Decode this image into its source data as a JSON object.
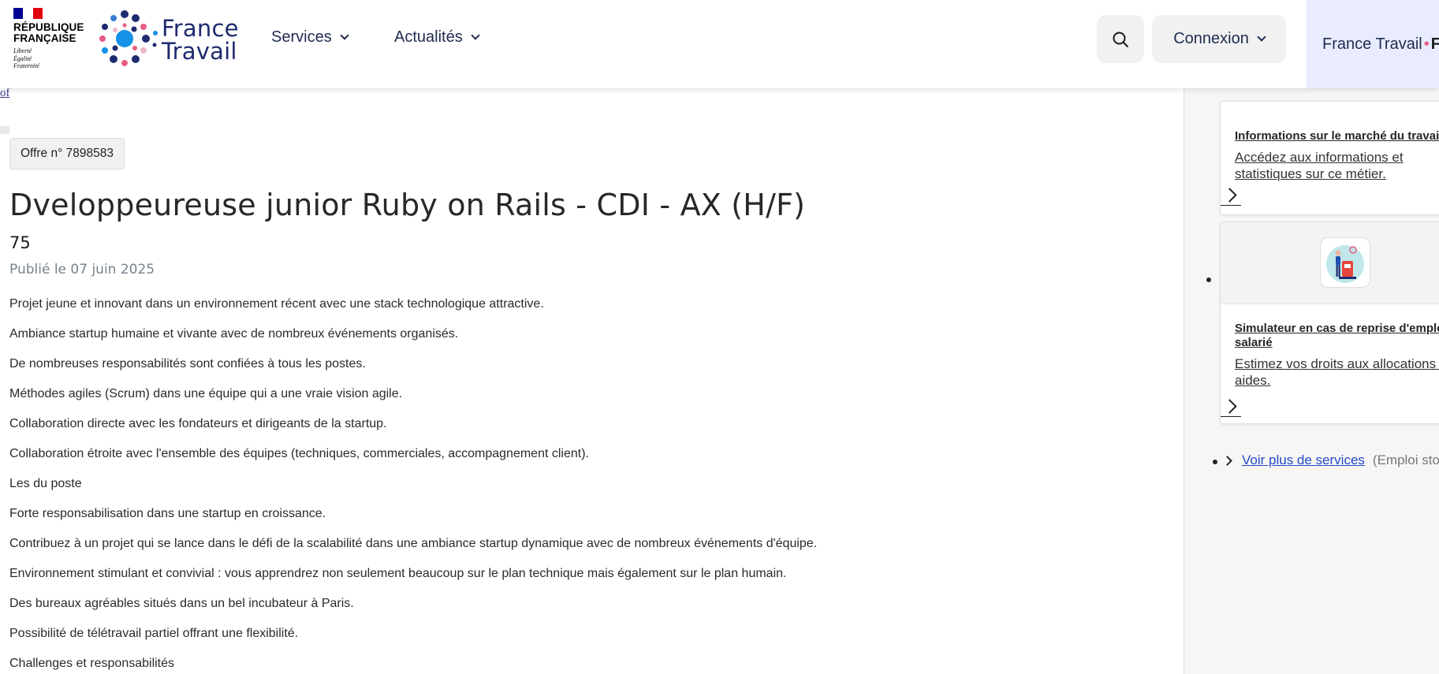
{
  "header": {
    "republique": {
      "line1": "RÉPUBLIQUE",
      "line2": "FRANÇAISE",
      "motto": [
        "Liberté",
        "Égalité",
        "Fraternité"
      ]
    },
    "brand": {
      "line1": "France",
      "line2": "Travail"
    },
    "nav": [
      {
        "label": "Services"
      },
      {
        "label": "Actualités"
      }
    ],
    "connexion_label": "Connexion",
    "pro_space": {
      "part1": "France Travail",
      "part2": "F"
    },
    "icons": {
      "search": "search-icon",
      "chevron": "chevron-down-icon"
    }
  },
  "skip_link": "of",
  "offer": {
    "badge": "Offre n° 7898583",
    "title": "Dveloppeureuse junior Ruby on Rails - CDI - AX (H/F)",
    "location": "75",
    "published": "Publié le 07 juin 2025",
    "description": [
      "Projet jeune et innovant dans un environnement récent avec une stack technologique attractive.",
      "Ambiance startup humaine et vivante avec de nombreux événements organisés.",
      "De nombreuses responsabilités sont confiées à tous les postes.",
      "Méthodes agiles (Scrum) dans une équipe qui a une vraie vision agile.",
      "Collaboration directe avec les fondateurs et dirigeants de la startup.",
      "Collaboration étroite avec l'ensemble des équipes (techniques, commerciales, accompagnement client).",
      "Les du poste",
      "Forte responsabilisation dans une startup en croissance.",
      "Contribuez à un projet qui se lance dans le défi de la scalabilité dans une ambiance startup dynamique avec de nombreux événements d'équipe.",
      "Environnement stimulant et convivial : vous apprendrez non seulement beaucoup sur le plan technique mais également sur le plan humain.",
      "Des bureaux agréables situés dans un bel incubateur à Paris.",
      "Possibilité de télétravail partiel offrant une flexibilité.",
      "Challenges et responsabilités"
    ]
  },
  "sidebar": {
    "cards": [
      {
        "title": "Informations sur le marché du travail",
        "description": "Accédez aux informations et statistiques sur ce métier."
      },
      {
        "title_line1": "Simulateur en cas de reprise d'emploi",
        "title_line2": "salarié",
        "description": "Estimez vos droits aux allocations et aides.",
        "icon": "simulator-illustration-icon"
      }
    ],
    "more_services": {
      "link": "Voir plus de services",
      "suffix": "(Emploi store)"
    }
  },
  "colors": {
    "brand_navy": "#1f2b6f",
    "pro_bg": "#e8ecfd",
    "link_blue": "#2448c8",
    "sidebar_bg": "#f6f6f6",
    "muted_grey": "#7a8290"
  }
}
